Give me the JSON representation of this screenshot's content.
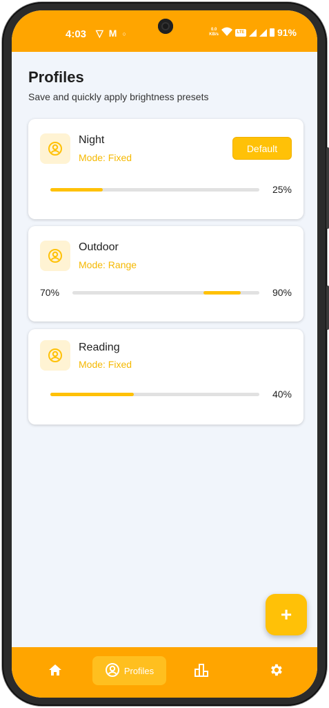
{
  "status_bar": {
    "time": "4:03",
    "left_icons": [
      "vpn-icon",
      "gmail-icon",
      "dot-icon"
    ],
    "net_speed_value": "0.0",
    "net_speed_unit": "KB/s",
    "battery": "91%"
  },
  "header": {
    "title": "Profiles",
    "subtitle": "Save and quickly apply brightness presets"
  },
  "profiles": [
    {
      "name": "Night",
      "mode": "Mode: Fixed",
      "default_label": "Default",
      "level": 0.25,
      "value_label": "25%"
    },
    {
      "name": "Outdoor",
      "mode": "Mode: Range",
      "min_label": "70%",
      "max_label": "90%",
      "range_min": 0.7,
      "range_max": 0.9
    },
    {
      "name": "Reading",
      "mode": "Mode: Fixed",
      "level": 0.4,
      "value_label": "40%"
    }
  ],
  "fab": {
    "label": "+"
  },
  "bottom_nav": {
    "items": [
      {
        "icon": "home-icon",
        "label": ""
      },
      {
        "icon": "profile-icon",
        "label": "Profiles"
      },
      {
        "icon": "chart-icon",
        "label": ""
      },
      {
        "icon": "gear-icon",
        "label": ""
      }
    ]
  },
  "colors": {
    "accent": "#ffa500",
    "accent_light": "#ffc107",
    "background": "#f1f5fb"
  }
}
